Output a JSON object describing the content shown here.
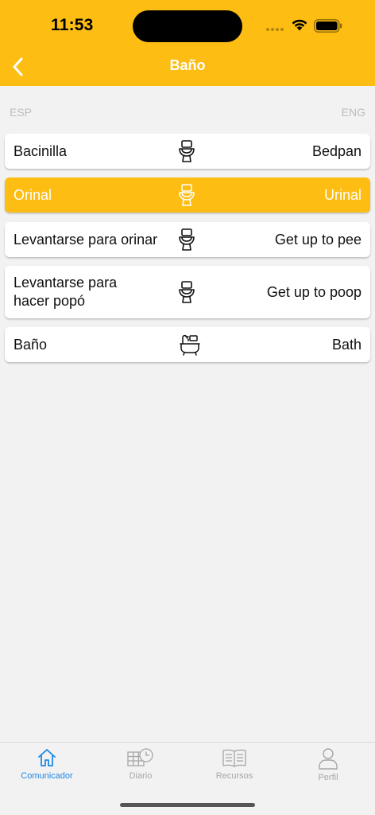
{
  "status": {
    "time": "11:53"
  },
  "header": {
    "title": "Baño"
  },
  "columns": {
    "left": "ESP",
    "right": "ENG"
  },
  "items": [
    {
      "esp": "Bacinilla",
      "eng": "Bedpan",
      "icon": "toilet-icon"
    },
    {
      "esp": "Orinal",
      "eng": "Urinal",
      "icon": "toilet-icon",
      "selected": true
    },
    {
      "esp": "Levantarse para orinar",
      "eng": "Get up to pee",
      "icon": "toilet-icon"
    },
    {
      "esp": "Levantarse para hacer popó",
      "eng": "Get up to poop",
      "icon": "toilet-icon"
    },
    {
      "esp": "Baño",
      "eng": "Bath",
      "icon": "bathtub-icon"
    }
  ],
  "tabs": [
    {
      "label": "Comunicador",
      "icon": "home-icon",
      "active": true
    },
    {
      "label": "Diario",
      "icon": "calendar-clock-icon"
    },
    {
      "label": "Recursos",
      "icon": "book-icon"
    },
    {
      "label": "Perfil",
      "icon": "person-icon"
    }
  ],
  "colors": {
    "accent": "#fdbd13",
    "tab_active": "#1e88e5",
    "tab_inactive": "#a6a6a6"
  }
}
